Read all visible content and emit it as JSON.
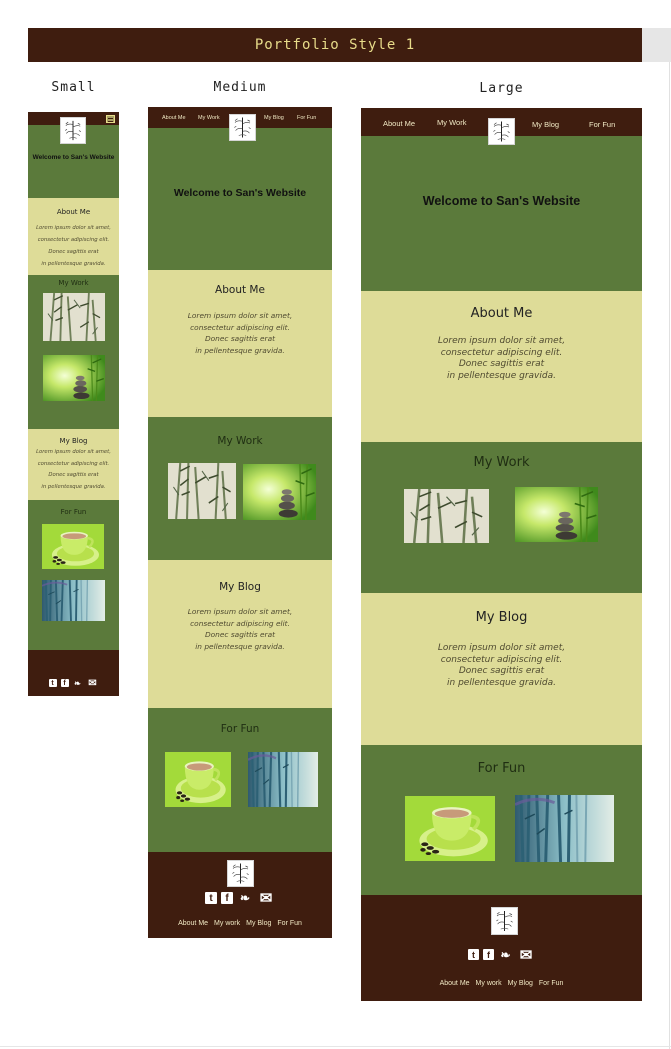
{
  "banner": {
    "title": "Portfolio Style 1"
  },
  "columns": {
    "small": "Small",
    "medium": "Medium",
    "large": "Large"
  },
  "nav": {
    "about": "About Me",
    "work": "My Work",
    "blog": "My Blog",
    "fun": "For Fun"
  },
  "hero": {
    "welcome": "Welcome to San's Website"
  },
  "sections": {
    "about": {
      "title": "About Me"
    },
    "work": {
      "title": "My Work"
    },
    "blog": {
      "title": "My Blog"
    },
    "fun": {
      "title": "For Fun"
    }
  },
  "lorem": {
    "line1": "Lorem ipsum dolor sit amet,",
    "line2": "consectetur adipiscing elit.",
    "line3": "Donec sagittis erat",
    "line4": "in pellentesque gravida."
  },
  "footer": {
    "about": "About Me",
    "work": "My work",
    "blog": "My Blog",
    "fun": "For Fun"
  },
  "social": {
    "tumblr": "t",
    "facebook": "f",
    "twitter": "❧",
    "mail": "✉"
  },
  "icons": [
    "bamboo-logo-icon",
    "hamburger-menu-icon",
    "tumblr-icon",
    "facebook-icon",
    "twitter-icon",
    "mail-icon"
  ],
  "colors": {
    "brown": "#3f1d0f",
    "green": "#5b7a3b",
    "khaki": "#dedc98",
    "banner_text": "#e8dc8a"
  }
}
